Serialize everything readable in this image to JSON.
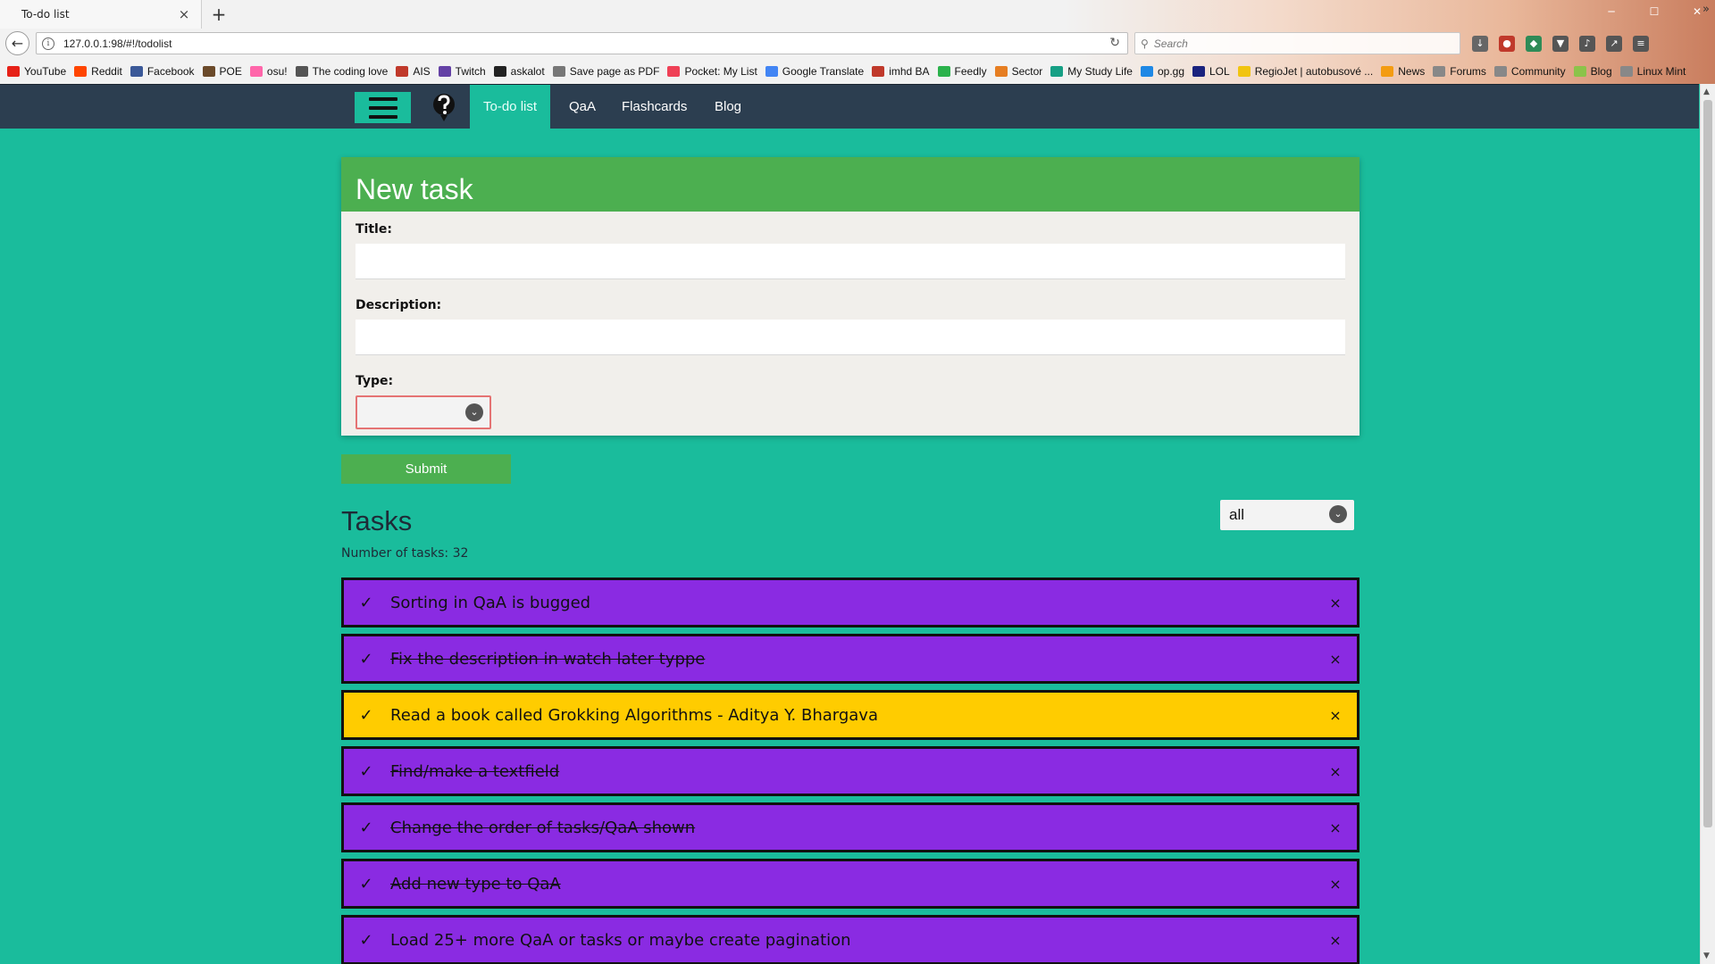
{
  "browser": {
    "tab_title": "To-do list",
    "tab_close": "×",
    "new_tab": "+",
    "url": "127.0.0.1:98/#!/todolist",
    "search_placeholder": "Search",
    "bookmarks": [
      {
        "label": "YouTube",
        "color": "#e62117"
      },
      {
        "label": "Reddit",
        "color": "#ff4500"
      },
      {
        "label": "Facebook",
        "color": "#3b5998"
      },
      {
        "label": "POE",
        "color": "#6b4a2a"
      },
      {
        "label": "osu!",
        "color": "#ff66aa"
      },
      {
        "label": "The coding love",
        "color": "#555555"
      },
      {
        "label": "AIS",
        "color": "#c0392b"
      },
      {
        "label": "Twitch",
        "color": "#6441a5"
      },
      {
        "label": "askalot",
        "color": "#222222"
      },
      {
        "label": "Save page as PDF",
        "color": "#777777"
      },
      {
        "label": "Pocket: My List",
        "color": "#ef4056"
      },
      {
        "label": "Google Translate",
        "color": "#4285f4"
      },
      {
        "label": "imhd BA",
        "color": "#c0392b"
      },
      {
        "label": "Feedly",
        "color": "#2bb24c"
      },
      {
        "label": "Sector",
        "color": "#e67e22"
      },
      {
        "label": "My Study Life",
        "color": "#16a085"
      },
      {
        "label": "op.gg",
        "color": "#1e88e5"
      },
      {
        "label": "LOL",
        "color": "#1a237e"
      },
      {
        "label": "RegioJet | autobusové ...",
        "color": "#f1c40f"
      },
      {
        "label": "News",
        "color": "#f39c12"
      },
      {
        "label": "Forums",
        "color": "#888888"
      },
      {
        "label": "Community",
        "color": "#888888"
      },
      {
        "label": "Blog",
        "color": "#8bc34a"
      },
      {
        "label": "Linux Mint",
        "color": "#888888"
      }
    ]
  },
  "nav": {
    "items": [
      {
        "label": "To-do list",
        "active": true
      },
      {
        "label": "QaA",
        "active": false
      },
      {
        "label": "Flashcards",
        "active": false
      },
      {
        "label": "Blog",
        "active": false
      }
    ]
  },
  "form": {
    "title": "New task",
    "title_label": "Title:",
    "title_value": "",
    "description_label": "Description:",
    "description_value": "",
    "type_label": "Type:",
    "type_value": "",
    "submit_label": "Submit"
  },
  "tasks": {
    "heading": "Tasks",
    "count_text": "Number of tasks: 32",
    "filter_value": "all",
    "check_glyph": "✓",
    "delete_glyph": "×",
    "items": [
      {
        "text": "Sorting in QaA is bugged",
        "color": "purple",
        "done": false
      },
      {
        "text": "Fix the description in watch later typpe",
        "color": "purple",
        "done": true
      },
      {
        "text": "Read a book called Grokking Algorithms - Aditya Y. Bhargava",
        "color": "yellow",
        "done": false
      },
      {
        "text": "Find/make a textfield",
        "color": "purple",
        "done": true
      },
      {
        "text": "Change the order of tasks/QaA shown",
        "color": "purple",
        "done": true
      },
      {
        "text": "Add new type to QaA",
        "color": "purple",
        "done": true
      },
      {
        "text": "Load 25+ more QaA or tasks or maybe create pagination",
        "color": "purple",
        "done": false
      }
    ]
  },
  "colors": {
    "background": "#1abc9c",
    "navbar": "#2c3e50",
    "card_header": "#4caf50",
    "task_purple": "#8a2be2",
    "task_yellow": "#ffcc00",
    "invalid_border": "#e57373"
  }
}
